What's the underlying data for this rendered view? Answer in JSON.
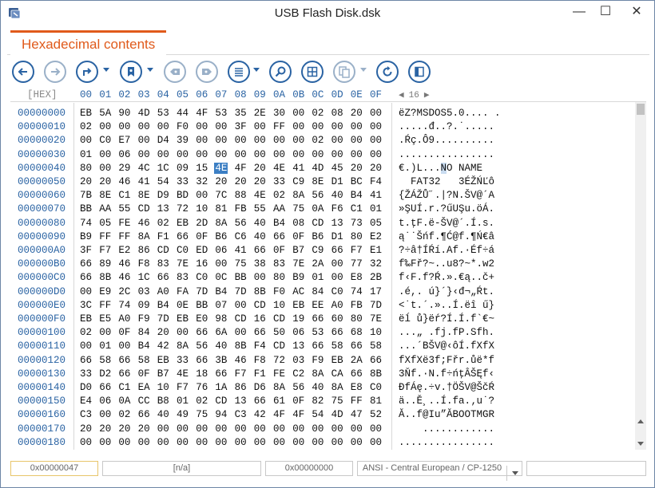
{
  "window": {
    "title": "USB Flash Disk.dsk",
    "min_glyph": "—",
    "max_glyph": "☐",
    "close_glyph": "✕"
  },
  "tab": {
    "label": "Hexadecimal contents"
  },
  "toolbar": {
    "icons": [
      "back-icon",
      "forward-icon",
      "goto-icon",
      "bookmark-icon",
      "prev-bookmark-icon",
      "next-bookmark-icon",
      "list-icon",
      "find-icon",
      "grid-icon",
      "copy-icon",
      "refresh-icon",
      "panel-icon"
    ]
  },
  "hex": {
    "label": "[HEX]",
    "columns": [
      "00",
      "01",
      "02",
      "03",
      "04",
      "05",
      "06",
      "07",
      "08",
      "09",
      "0A",
      "0B",
      "0C",
      "0D",
      "0E",
      "0F"
    ],
    "pager": {
      "left": "◀",
      "value": "16",
      "right": "▶"
    },
    "rows": [
      {
        "offset": "00000000",
        "bytes": [
          "EB",
          "5A",
          "90",
          "4D",
          "53",
          "44",
          "4F",
          "53",
          "35",
          "2E",
          "30",
          "00",
          "02",
          "08",
          "20",
          "00"
        ],
        "text": "ëZ?MSDOS5.0.... ."
      },
      {
        "offset": "00000010",
        "bytes": [
          "02",
          "00",
          "00",
          "00",
          "00",
          "F0",
          "00",
          "00",
          "3F",
          "00",
          "FF",
          "00",
          "00",
          "00",
          "00",
          "00"
        ],
        "text": ".....đ..?.˙....."
      },
      {
        "offset": "00000020",
        "bytes": [
          "00",
          "C0",
          "E7",
          "00",
          "D4",
          "39",
          "00",
          "00",
          "00",
          "00",
          "00",
          "00",
          "02",
          "00",
          "00",
          "00"
        ],
        "text": ".Ŕç.Ô9.........."
      },
      {
        "offset": "00000030",
        "bytes": [
          "01",
          "00",
          "06",
          "00",
          "00",
          "00",
          "00",
          "00",
          "00",
          "00",
          "00",
          "00",
          "00",
          "00",
          "00",
          "00"
        ],
        "text": "................"
      },
      {
        "offset": "00000040",
        "bytes": [
          "80",
          "00",
          "29",
          "4C",
          "1C",
          "09",
          "15",
          "4E",
          "4F",
          "20",
          "4E",
          "41",
          "4D",
          "45",
          "20",
          "20"
        ],
        "text": "€.)L...NO NAME  "
      },
      {
        "offset": "00000050",
        "bytes": [
          "20",
          "20",
          "46",
          "41",
          "54",
          "33",
          "32",
          "20",
          "20",
          "20",
          "33",
          "C9",
          "8E",
          "D1",
          "BC",
          "F4"
        ],
        "text": "  FAT32   3ÉŽŃĽô"
      },
      {
        "offset": "00000060",
        "bytes": [
          "7B",
          "8E",
          "C1",
          "8E",
          "D9",
          "BD",
          "00",
          "7C",
          "88",
          "4E",
          "02",
          "8A",
          "56",
          "40",
          "B4",
          "41"
        ],
        "text": "{ŽÁŽŮ˝.|?N.ŠV@´A"
      },
      {
        "offset": "00000070",
        "bytes": [
          "BB",
          "AA",
          "55",
          "CD",
          "13",
          "72",
          "10",
          "81",
          "FB",
          "55",
          "AA",
          "75",
          "0A",
          "F6",
          "C1",
          "01"
        ],
        "text": "»ŞUÍ.r.?űUŞu.öÁ."
      },
      {
        "offset": "00000080",
        "bytes": [
          "74",
          "05",
          "FE",
          "46",
          "02",
          "EB",
          "2D",
          "8A",
          "56",
          "40",
          "B4",
          "08",
          "CD",
          "13",
          "73",
          "05"
        ],
        "text": "t.ţF.ë-ŠV@´.Í.s."
      },
      {
        "offset": "00000090",
        "bytes": [
          "B9",
          "FF",
          "FF",
          "8A",
          "F1",
          "66",
          "0F",
          "B6",
          "C6",
          "40",
          "66",
          "0F",
          "B6",
          "D1",
          "80",
          "E2"
        ],
        "text": "ą˙˙Šńf.¶Ć@f.¶Ń€â"
      },
      {
        "offset": "000000A0",
        "bytes": [
          "3F",
          "F7",
          "E2",
          "86",
          "CD",
          "C0",
          "ED",
          "06",
          "41",
          "66",
          "0F",
          "B7",
          "C9",
          "66",
          "F7",
          "E1"
        ],
        "text": "?÷â†ÍŔí.Af.·Éf÷á"
      },
      {
        "offset": "000000B0",
        "bytes": [
          "66",
          "89",
          "46",
          "F8",
          "83",
          "7E",
          "16",
          "00",
          "75",
          "38",
          "83",
          "7E",
          "2A",
          "00",
          "77",
          "32"
        ],
        "text": "f‰Fř?~..u8?~*.w2"
      },
      {
        "offset": "000000C0",
        "bytes": [
          "66",
          "8B",
          "46",
          "1C",
          "66",
          "83",
          "C0",
          "0C",
          "BB",
          "00",
          "80",
          "B9",
          "01",
          "00",
          "E8",
          "2B"
        ],
        "text": "f‹F.f?Ŕ.».€ą..č+"
      },
      {
        "offset": "000000D0",
        "bytes": [
          "00",
          "E9",
          "2C",
          "03",
          "A0",
          "FA",
          "7D",
          "B4",
          "7D",
          "8B",
          "F0",
          "AC",
          "84",
          "C0",
          "74",
          "17"
        ],
        "text": ".é,. ú}´}‹đ¬„Ŕt."
      },
      {
        "offset": "000000E0",
        "bytes": [
          "3C",
          "FF",
          "74",
          "09",
          "B4",
          "0E",
          "BB",
          "07",
          "00",
          "CD",
          "10",
          "EB",
          "EE",
          "A0",
          "FB",
          "7D"
        ],
        "text": "<˙t.´.»..Í.ëî ű}"
      },
      {
        "offset": "000000F0",
        "bytes": [
          "EB",
          "E5",
          "A0",
          "F9",
          "7D",
          "EB",
          "E0",
          "98",
          "CD",
          "16",
          "CD",
          "19",
          "66",
          "60",
          "80",
          "7E"
        ],
        "text": "ëĺ ů}ëŕ?Í.Í.f`€~"
      },
      {
        "offset": "00000100",
        "bytes": [
          "02",
          "00",
          "0F",
          "84",
          "20",
          "00",
          "66",
          "6A",
          "00",
          "66",
          "50",
          "06",
          "53",
          "66",
          "68",
          "10"
        ],
        "text": "...„ .fj.fP.Sfh."
      },
      {
        "offset": "00000110",
        "bytes": [
          "00",
          "01",
          "00",
          "B4",
          "42",
          "8A",
          "56",
          "40",
          "8B",
          "F4",
          "CD",
          "13",
          "66",
          "58",
          "66",
          "58"
        ],
        "text": "...´BŠV@‹ôÍ.fXfX"
      },
      {
        "offset": "00000120",
        "bytes": [
          "66",
          "58",
          "66",
          "58",
          "EB",
          "33",
          "66",
          "3B",
          "46",
          "F8",
          "72",
          "03",
          "F9",
          "EB",
          "2A",
          "66"
        ],
        "text": "fXfXë3f;Fřr.ůë*f"
      },
      {
        "offset": "00000130",
        "bytes": [
          "33",
          "D2",
          "66",
          "0F",
          "B7",
          "4E",
          "18",
          "66",
          "F7",
          "F1",
          "FE",
          "C2",
          "8A",
          "CA",
          "66",
          "8B"
        ],
        "text": "3Ňf.·N.f÷ńţÂŠĘf‹"
      },
      {
        "offset": "00000140",
        "bytes": [
          "D0",
          "66",
          "C1",
          "EA",
          "10",
          "F7",
          "76",
          "1A",
          "86",
          "D6",
          "8A",
          "56",
          "40",
          "8A",
          "E8",
          "C0"
        ],
        "text": "ĐfÁę.÷v.†ÖŠV@ŠčŔ"
      },
      {
        "offset": "00000150",
        "bytes": [
          "E4",
          "06",
          "0A",
          "CC",
          "B8",
          "01",
          "02",
          "CD",
          "13",
          "66",
          "61",
          "0F",
          "82",
          "75",
          "FF",
          "81"
        ],
        "text": "ä..Ě¸..Í.fa.‚u˙?"
      },
      {
        "offset": "00000160",
        "bytes": [
          "C3",
          "00",
          "02",
          "66",
          "40",
          "49",
          "75",
          "94",
          "C3",
          "42",
          "4F",
          "4F",
          "54",
          "4D",
          "47",
          "52"
        ],
        "text": "Ă..f@Iu”ĂBOOTMGR"
      },
      {
        "offset": "00000170",
        "bytes": [
          "20",
          "20",
          "20",
          "20",
          "00",
          "00",
          "00",
          "00",
          "00",
          "00",
          "00",
          "00",
          "00",
          "00",
          "00",
          "00"
        ],
        "text": "    ............"
      },
      {
        "offset": "00000180",
        "bytes": [
          "00",
          "00",
          "00",
          "00",
          "00",
          "00",
          "00",
          "00",
          "00",
          "00",
          "00",
          "00",
          "00",
          "00",
          "00",
          "00"
        ],
        "text": "................"
      }
    ]
  },
  "status": {
    "offset": "0x00000047",
    "value": "[n/a]",
    "base": "0x00000000",
    "encoding": "ANSI - Central European / CP-1250",
    "extra": ""
  }
}
